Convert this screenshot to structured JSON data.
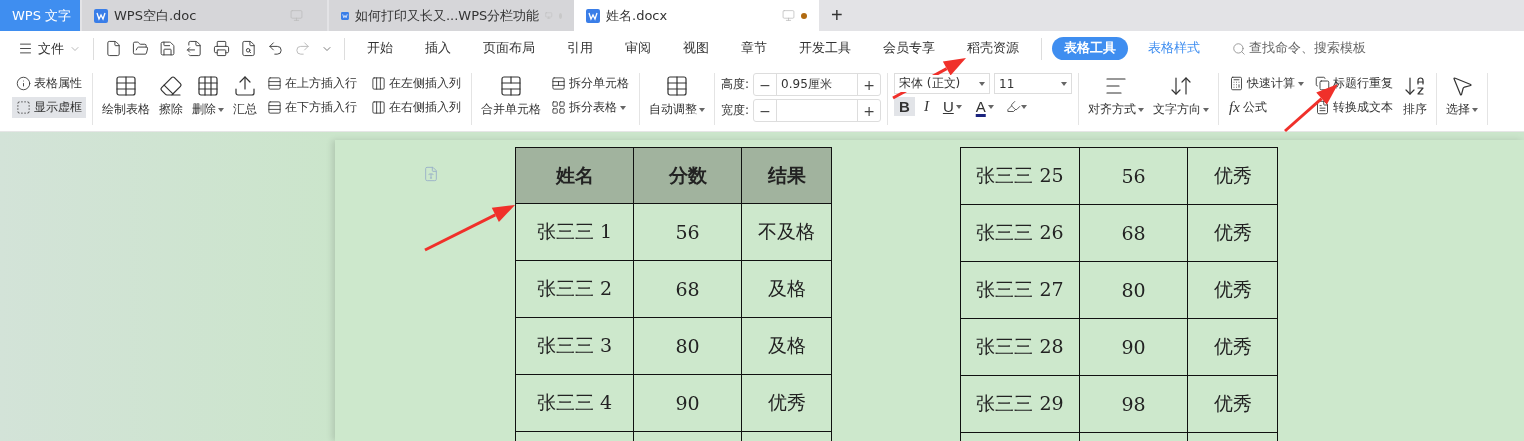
{
  "app_tabs": [
    {
      "label": "WPS 文字",
      "kind": "home",
      "selected": false
    },
    {
      "label": "WPS空白.doc",
      "kind": "doc",
      "selected": false,
      "dot": false
    },
    {
      "label": "如何打印又长又...WPS分栏功能",
      "kind": "doc",
      "selected": false,
      "dot": true
    },
    {
      "label": "姓名.docx",
      "kind": "doc",
      "selected": true,
      "dot": true
    }
  ],
  "new_tab": "+",
  "file_menu": "文件",
  "ribbon_tabs": [
    {
      "label": "开始",
      "kind": "normal",
      "selected": false
    },
    {
      "label": "插入",
      "kind": "normal",
      "selected": false
    },
    {
      "label": "页面布局",
      "kind": "normal",
      "selected": false
    },
    {
      "label": "引用",
      "kind": "normal",
      "selected": false
    },
    {
      "label": "审阅",
      "kind": "normal",
      "selected": false
    },
    {
      "label": "视图",
      "kind": "normal",
      "selected": false
    },
    {
      "label": "章节",
      "kind": "normal",
      "selected": false
    },
    {
      "label": "开发工具",
      "kind": "normal",
      "selected": false
    },
    {
      "label": "会员专享",
      "kind": "normal",
      "selected": false
    },
    {
      "label": "稻壳资源",
      "kind": "normal",
      "selected": false
    },
    {
      "label": "表格工具",
      "kind": "context",
      "selected": true
    },
    {
      "label": "表格样式",
      "kind": "context",
      "selected": false
    }
  ],
  "search": {
    "placeholder": "查找命令、搜索模板"
  },
  "ribbon": {
    "table_props": {
      "label": "表格属性",
      "selected": false
    },
    "show_gridlines": {
      "label": "显示虚框",
      "selected": true
    },
    "large_tools": [
      {
        "label": "绘制表格",
        "dropdown": false
      },
      {
        "label": "擦除",
        "dropdown": false
      },
      {
        "label": "删除",
        "dropdown": true
      },
      {
        "label": "汇总",
        "dropdown": false
      }
    ],
    "insert_tools": [
      {
        "label": "在上方插入行"
      },
      {
        "label": "在下方插入行"
      },
      {
        "label": "在左侧插入列"
      },
      {
        "label": "在右侧插入列"
      }
    ],
    "merge": {
      "label": "合并单元格"
    },
    "split_cells": {
      "label": "拆分单元格"
    },
    "split_table": {
      "label": "拆分表格"
    },
    "auto_fit": {
      "label": "自动调整"
    },
    "height": {
      "label": "高度:",
      "value": "0.95厘米",
      "minus": "−",
      "plus": "+"
    },
    "width": {
      "label": "宽度:",
      "minus": "−",
      "plus": "+"
    },
    "font": {
      "name": "宋体 (正文)",
      "size": "11"
    },
    "format": [
      {
        "label": "B",
        "kind": "bold",
        "selected": true,
        "dropdown": false
      },
      {
        "label": "I",
        "kind": "italic",
        "selected": false,
        "dropdown": false
      },
      {
        "label": "U",
        "kind": "underline",
        "selected": false,
        "dropdown": true
      },
      {
        "label": "A",
        "kind": "color",
        "selected": false,
        "dropdown": true
      }
    ],
    "align": {
      "label": "对齐方式"
    },
    "direction": {
      "label": "文字方向"
    },
    "quick_calc": {
      "label": "快速计算"
    },
    "formula": {
      "label": "公式",
      "glyph": "fx"
    },
    "repeat_header": {
      "label": "标题行重复"
    },
    "to_text": {
      "label": "转换成文本"
    },
    "sort": {
      "label": "排序"
    },
    "select": {
      "label": "选择"
    }
  },
  "tables": [
    {
      "header": [
        "姓名",
        "分数",
        "结果"
      ],
      "rows": [
        [
          "张三三 1",
          "56",
          "不及格"
        ],
        [
          "张三三 2",
          "68",
          "及格"
        ],
        [
          "张三三 3",
          "80",
          "及格"
        ],
        [
          "张三三 4",
          "90",
          "优秀"
        ]
      ]
    },
    {
      "rows": [
        [
          "张三三 25",
          "56",
          "优秀"
        ],
        [
          "张三三 26",
          "68",
          "优秀"
        ],
        [
          "张三三 27",
          "80",
          "优秀"
        ],
        [
          "张三三 28",
          "90",
          "优秀"
        ],
        [
          "张三三 29",
          "98",
          "优秀"
        ]
      ]
    }
  ]
}
